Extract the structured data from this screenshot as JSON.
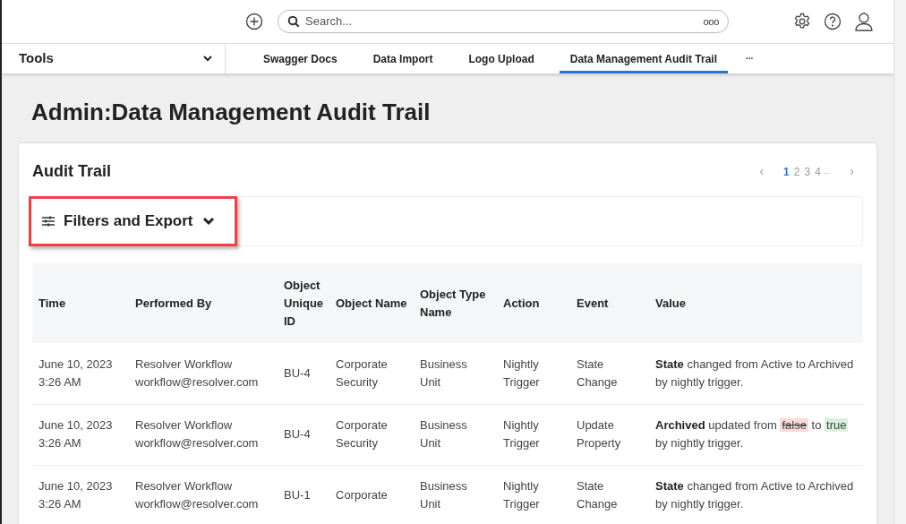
{
  "top_bar": {
    "search": {
      "placeholder": "Search...",
      "options": "ooo"
    }
  },
  "nav": {
    "menu": "Tools",
    "tabs": [
      {
        "label": "Swagger Docs",
        "selected": false
      },
      {
        "label": "Data Import",
        "selected": false
      },
      {
        "label": "Logo Upload",
        "selected": false
      },
      {
        "label": "Data Management Audit Trail",
        "selected": true
      }
    ],
    "more": "..."
  },
  "page_title": {
    "prefix": "Admin",
    "separator": ":",
    "title": "Data Management Audit Trail"
  },
  "card": {
    "title": "Audit Trail",
    "pagination": {
      "prev": "‹",
      "next": "›",
      "ellipsis": "...",
      "pages": [
        {
          "label": "1",
          "selected": true
        },
        {
          "label": "2",
          "selected": false
        },
        {
          "label": "3",
          "selected": false
        },
        {
          "label": "4",
          "selected": false
        }
      ]
    },
    "filters_button": "Filters and Export",
    "table": {
      "columns": [
        "Time",
        "Performed By",
        "Object Unique ID",
        "Object Name",
        "Object Type Name",
        "Action",
        "Event",
        "Value"
      ],
      "rows": [
        {
          "time": [
            "June 10, 2023",
            "3:26 AM"
          ],
          "performed_by": [
            "Resolver Workflow",
            "workflow@resolver.com"
          ],
          "id": "BU-4",
          "object_name": "Corporate Security",
          "type": "Business Unit",
          "action": "Nightly Trigger",
          "event": "State Change",
          "value": [
            {
              "kind": "bold",
              "text": "State"
            },
            {
              "kind": "text",
              "text": " changed from Active to Archived by nightly trigger."
            }
          ]
        },
        {
          "time": [
            "June 10, 2023",
            "3:26 AM"
          ],
          "performed_by": [
            "Resolver Workflow",
            "workflow@resolver.com"
          ],
          "id": "BU-4",
          "object_name": "Corporate Security",
          "type": "Business Unit",
          "action": "Nightly Trigger",
          "event": "Update Property",
          "value": [
            {
              "kind": "bold",
              "text": "Archived"
            },
            {
              "kind": "text",
              "text": " updated from "
            },
            {
              "kind": "removed",
              "text": "false"
            },
            {
              "kind": "text",
              "text": " to "
            },
            {
              "kind": "added",
              "text": "true"
            },
            {
              "kind": "text",
              "text": " by nightly trigger."
            }
          ]
        },
        {
          "time": [
            "June 10, 2023",
            "3:26 AM"
          ],
          "performed_by": [
            "Resolver Workflow",
            "workflow@resolver.com"
          ],
          "id": "BU-1",
          "object_name": "Corporate",
          "type": "Business Unit",
          "action": "Nightly Trigger",
          "event": "State Change",
          "value": [
            {
              "kind": "bold",
              "text": "State"
            },
            {
              "kind": "text",
              "text": " changed from Active to Archived by nightly trigger."
            }
          ]
        }
      ]
    }
  }
}
